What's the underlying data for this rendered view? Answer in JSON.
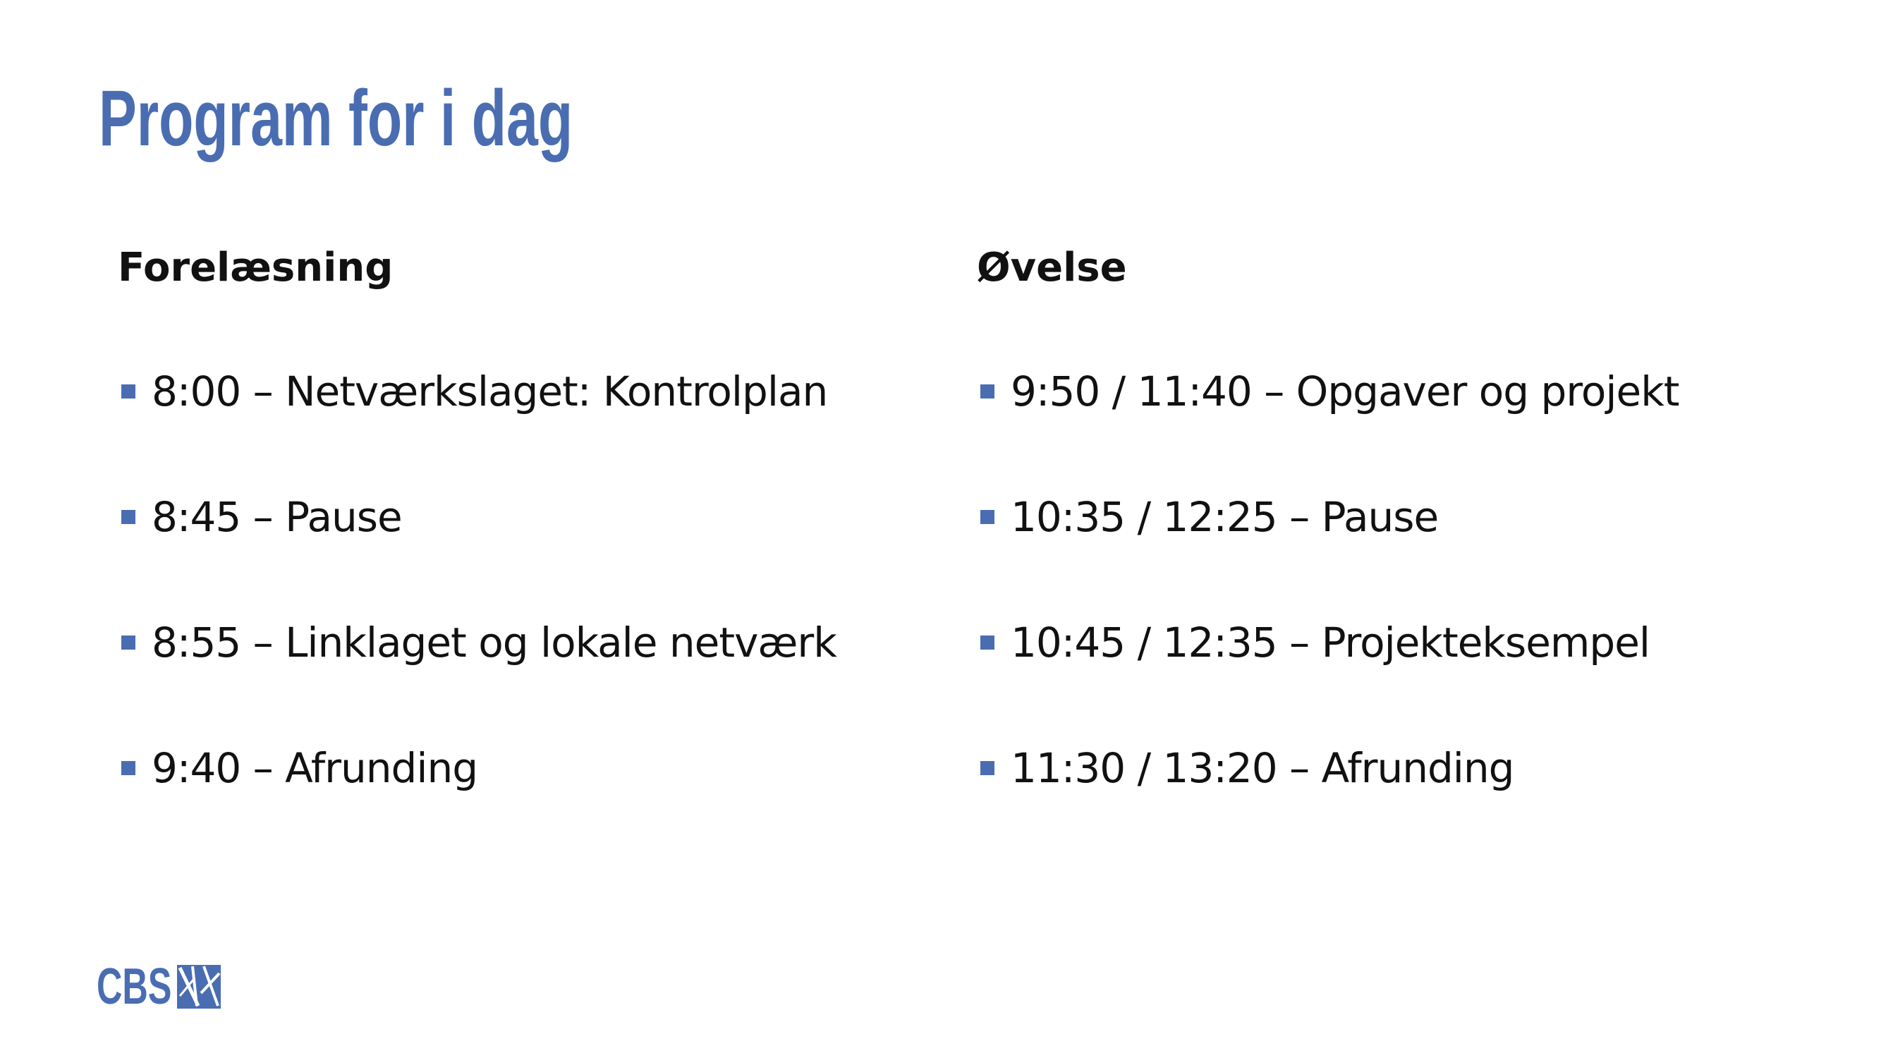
{
  "slide": {
    "title": "Program for i dag",
    "columns": [
      {
        "heading": "Forelæsning",
        "items": [
          "8:00 – Netværkslaget: Kontrolplan",
          "8:45 – Pause",
          "8:55 – Linklaget og lokale netværk",
          "9:40 – Afrunding"
        ]
      },
      {
        "heading": "Øvelse",
        "items": [
          "9:50 / 11:40 – Opgaver og projekt",
          "10:35 / 12:25 – Pause",
          "10:45 / 12:35 – Projekteksempel",
          "11:30 / 13:20 – Afrunding"
        ]
      }
    ]
  },
  "logo": {
    "text": "CBS",
    "icon": "cbs-logo-mark-icon"
  },
  "colors": {
    "accent": "#4a6db2",
    "text": "#111111",
    "background": "#ffffff"
  }
}
